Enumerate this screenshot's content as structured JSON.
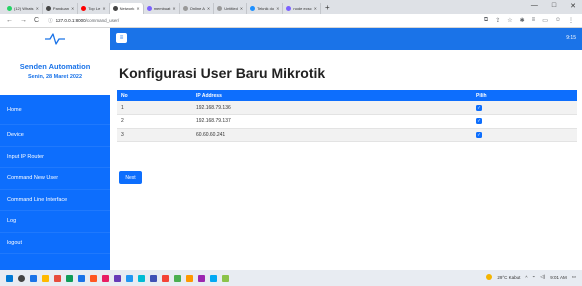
{
  "browser": {
    "tabs": [
      {
        "title": "(12) Whats",
        "color": "#25d366"
      },
      {
        "title": "Panduan",
        "color": "#444"
      },
      {
        "title": "Top Le",
        "color": "#ff0000"
      },
      {
        "title": "Network",
        "color": "#444",
        "active": true
      },
      {
        "title": "membuat",
        "color": "#7b61ff"
      },
      {
        "title": "Online A",
        "color": "#999"
      },
      {
        "title": "Untitled",
        "color": "#999"
      },
      {
        "title": "Teknik do",
        "color": "#1e90ff"
      },
      {
        "title": "node ecsc",
        "color": "#7b61ff"
      }
    ],
    "new_tab": "+",
    "window_controls": {
      "minimize": "—",
      "maximize": "□",
      "close": "✕"
    },
    "nav": {
      "back": "←",
      "forward": "→",
      "reload": "C"
    },
    "url_host": "127.0.0.1:8000",
    "url_path": "/command_user/",
    "info_icon": "ⓘ"
  },
  "app": {
    "clock": "9:15",
    "menu_toggle": "≡",
    "brand_name": "Senden Automation",
    "brand_date": "Senin, 28 Maret 2022",
    "sidebar": [
      "Home",
      "Device",
      "Input IP Router",
      "Command New User",
      "Command Line Interface",
      "Log",
      "logout"
    ],
    "page_title": "Konfigurasi User Baru Mikrotik",
    "table": {
      "headers": [
        "No",
        "IP Address",
        "Pilih"
      ],
      "rows": [
        {
          "no": "1",
          "ip": "192.168.79.136",
          "checked": true
        },
        {
          "no": "2",
          "ip": "192.168.79.137",
          "checked": true
        },
        {
          "no": "3",
          "ip": "60.60.60.241",
          "checked": true
        }
      ]
    },
    "next_label": "Next",
    "accent_color": "#0d6efd"
  },
  "taskbar": {
    "weather": "29°C Kabut",
    "time": "9:01 AM",
    "icon_colors": [
      "#0078d4",
      "#444",
      "#1a73e8",
      "#ffb900",
      "#e74c3c",
      "#0f9d58",
      "#1a73e8",
      "#ff5722",
      "#e91e63",
      "#673ab7",
      "#2196f3",
      "#00bcd4",
      "#3f51b5",
      "#f44336",
      "#4caf50",
      "#ff9800",
      "#9c27b0",
      "#03a9f4",
      "#8bc34a"
    ]
  }
}
